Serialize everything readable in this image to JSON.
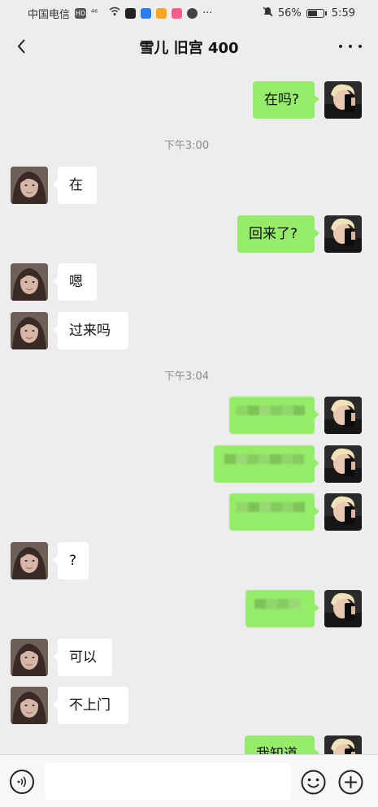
{
  "status_bar": {
    "carrier": "中国电信",
    "hd": "HD",
    "signal": "⁴⁶",
    "dots": "···",
    "battery_pct": "56%",
    "time": "5:59"
  },
  "navbar": {
    "title": "雪儿 旧宫 400"
  },
  "messages": [
    {
      "sender": "me",
      "text": "在吗?"
    },
    {
      "type": "time",
      "text": "下午3:00"
    },
    {
      "sender": "her",
      "text": "在"
    },
    {
      "sender": "me",
      "text": "回来了?"
    },
    {
      "sender": "her",
      "text": "嗯"
    },
    {
      "sender": "her",
      "text": "过来吗"
    },
    {
      "type": "time",
      "text": "下午3:04"
    },
    {
      "sender": "me",
      "text": "",
      "blurred": true
    },
    {
      "sender": "me",
      "text": "",
      "blurred": true
    },
    {
      "sender": "me",
      "text": "",
      "blurred": true
    },
    {
      "sender": "her",
      "text": "?"
    },
    {
      "sender": "me",
      "text": "",
      "blurred": true
    },
    {
      "sender": "her",
      "text": "可以"
    },
    {
      "sender": "her",
      "text": "不上门"
    },
    {
      "sender": "me",
      "text": "我知道"
    }
  ],
  "input": {
    "value": "",
    "placeholder": ""
  },
  "colors": {
    "my_bubble": "#95ec69",
    "her_bubble": "#ffffff",
    "background": "#ededed"
  }
}
